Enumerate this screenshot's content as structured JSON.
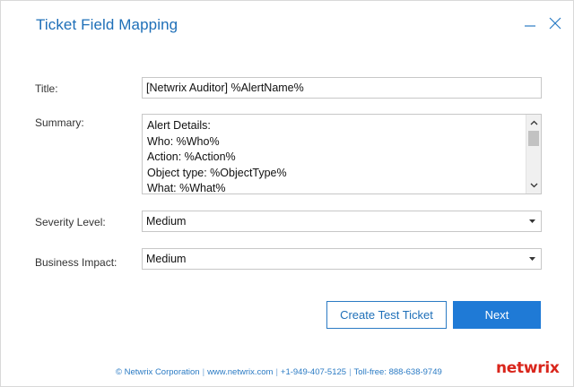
{
  "window": {
    "title": "Ticket Field Mapping"
  },
  "form": {
    "title_label": "Title:",
    "title_value": "[Netwrix Auditor] %AlertName%",
    "summary_label": "Summary:",
    "summary_lines": [
      "Alert Details:",
      "Who: %Who%",
      "Action: %Action%",
      "Object type: %ObjectType%",
      "What: %What%"
    ],
    "severity_label": "Severity Level:",
    "severity_value": "Medium",
    "impact_label": "Business Impact:",
    "impact_value": "Medium"
  },
  "buttons": {
    "create_test_ticket": "Create Test Ticket",
    "next": "Next"
  },
  "footer": {
    "copyright": "© Netwrix Corporation",
    "website": "www.netwrix.com",
    "phone": "+1-949-407-5125",
    "tollfree": "Toll-free: 888-638-9749"
  },
  "logo": {
    "text": "netwrix"
  },
  "colors": {
    "accent": "#1e6fb8",
    "primary_button": "#1f7ad6",
    "logo": "#d9261c"
  }
}
